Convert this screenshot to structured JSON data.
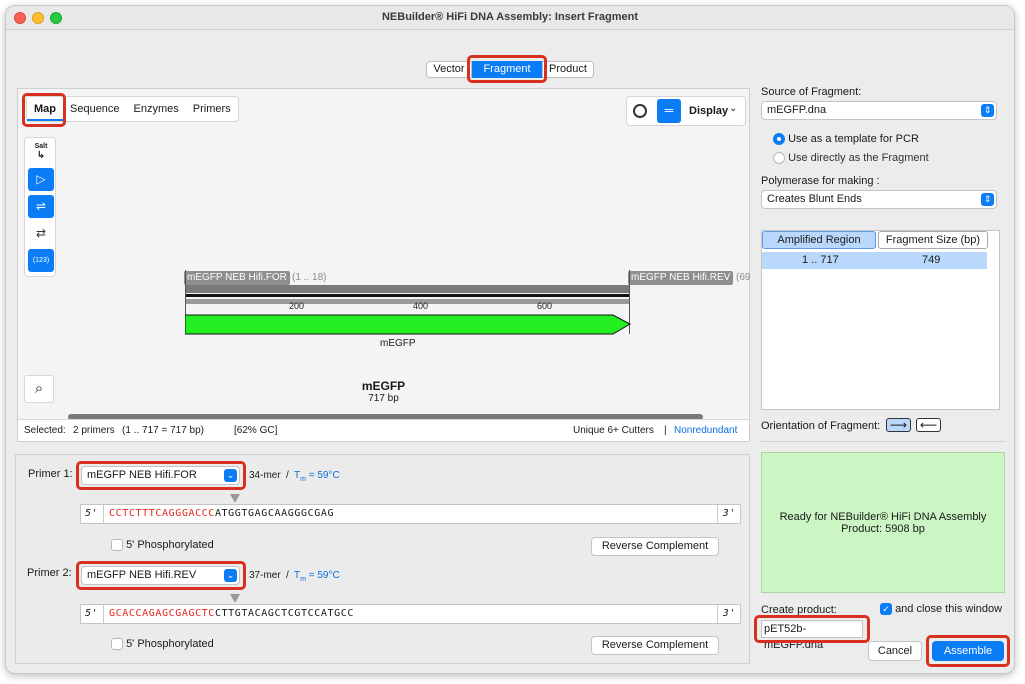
{
  "window": {
    "title": "NEBuilder® HiFi DNA Assembly: Insert Fragment"
  },
  "mode_tabs": [
    "Vector",
    "Fragment",
    "Product"
  ],
  "map_tabs": [
    "Map",
    "Sequence",
    "Enzymes",
    "Primers"
  ],
  "display_label": "Display",
  "side_tools": {
    "salt_label": "Salt",
    "numbers_label": "(123)"
  },
  "map": {
    "primer_for_label": "mEGFP NEB Hifi.FOR",
    "primer_for_range": "(1 .. 18)",
    "primer_rev_label": "mEGFP NEB Hifi.REV",
    "primer_rev_range": "(69",
    "ticks": [
      "200",
      "400",
      "600"
    ],
    "feature_label": "mEGFP",
    "seq_name": "mEGFP",
    "seq_length": "717 bp"
  },
  "status": {
    "selected": "Selected:",
    "primers": "2 primers",
    "range": "(1 .. 717  =  717 bp)",
    "gc": "[62% GC]",
    "cutters": "Unique 6+ Cutters",
    "separator": "|",
    "nonredundant": "Nonredundant"
  },
  "primer1": {
    "label": "Primer 1:",
    "name": "mEGFP NEB Hifi.FOR",
    "mer": "34-mer",
    "tm": "T",
    "tm_sub": "m",
    "tm_value": "= 59°C",
    "five": "5'",
    "three": "3'",
    "seq_red": "CCTCTTTCAGGGACCC",
    "seq_black": "ATGGTGAGCAAGGGCGAG",
    "phos": "5' Phosphorylated",
    "rc": "Reverse Complement"
  },
  "primer2": {
    "label": "Primer 2:",
    "name": "mEGFP NEB Hifi.REV",
    "mer": "37-mer",
    "tm": "T",
    "tm_sub": "m",
    "tm_value": "= 59°C",
    "five": "5'",
    "three": "3'",
    "seq_red": "GCACCAGAGCGAGCTC",
    "seq_black": "CTTGTACAGCTCGTCCATGCC",
    "phos": "5' Phosphorylated",
    "rc": "Reverse Complement"
  },
  "source": {
    "label": "Source of Fragment:",
    "file": "mEGFP.dna",
    "opt1": "Use as a template for PCR",
    "opt2": "Use directly as the Fragment"
  },
  "polymerase": {
    "label": "Polymerase for making :",
    "value": "Creates Blunt Ends"
  },
  "region": {
    "col1": "Amplified Region",
    "col2": "Fragment Size (bp)",
    "row_range": "1  ..  717",
    "row_size": "749"
  },
  "orientation_label": "Orientation of Fragment:",
  "ready": {
    "line1": "Ready for NEBuilder® HiFi DNA Assembly",
    "line2": "Product:  5908 bp"
  },
  "create": {
    "label": "Create product:",
    "close_label": "and close this window",
    "name": "pET52b-mEGFP.dna"
  },
  "buttons": {
    "cancel": "Cancel",
    "assemble": "Assemble"
  },
  "colors": {
    "accent": "#0a7cf5",
    "highlight": "#d83020",
    "feature": "#22ee22",
    "ready_bg": "#ccf5c4",
    "primer_red": "#e8271b"
  }
}
